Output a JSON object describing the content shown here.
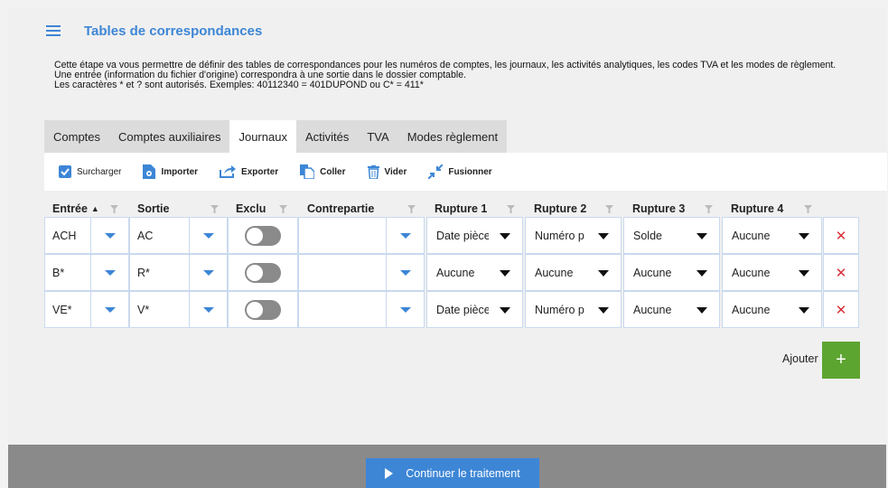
{
  "header": {
    "title": "Tables de correspondances"
  },
  "description": {
    "line1": "Cette étape va vous permettre de définir des tables de correspondances pour les numéros de comptes, les journaux, les activités analytiques, les codes TVA et les modes de règlement.",
    "line2": "Une entrée (information du fichier d'origine) correspondra à une sortie dans le dossier comptable.",
    "line3": "Les caractères * et ? sont autorisés. Exemples: 40112340 = 401DUPOND ou C* = 411*"
  },
  "tabs": [
    {
      "label": "Comptes",
      "active": false
    },
    {
      "label": "Comptes auxiliaires",
      "active": false
    },
    {
      "label": "Journaux",
      "active": true
    },
    {
      "label": "Activités",
      "active": false
    },
    {
      "label": "TVA",
      "active": false
    },
    {
      "label": "Modes règlement",
      "active": false
    }
  ],
  "toolbar": {
    "surcharger": "Surcharger",
    "importer": "Importer",
    "exporter": "Exporter",
    "coller": "Coller",
    "vider": "Vider",
    "fusionner": "Fusionner"
  },
  "columns": {
    "entree": "Entrée",
    "sortie": "Sortie",
    "exclu": "Exclu",
    "contrepartie": "Contrepartie",
    "rupture1": "Rupture 1",
    "rupture2": "Rupture 2",
    "rupture3": "Rupture 3",
    "rupture4": "Rupture 4"
  },
  "rows": [
    {
      "entree": "ACH",
      "sortie": "AC",
      "exclu": false,
      "contrepartie": "",
      "r1": "Date pièce",
      "r2": "Numéro p",
      "r3": "Solde",
      "r4": "Aucune"
    },
    {
      "entree": "B*",
      "sortie": "R*",
      "exclu": false,
      "contrepartie": "",
      "r1": "Aucune",
      "r2": "Aucune",
      "r3": "Aucune",
      "r4": "Aucune"
    },
    {
      "entree": "VE*",
      "sortie": "V*",
      "exclu": false,
      "contrepartie": "",
      "r1": "Date pièce",
      "r2": "Numéro p",
      "r3": "Aucune",
      "r4": "Aucune"
    }
  ],
  "actions": {
    "add_label": "Ajouter",
    "continue_label": "Continuer le traitement"
  },
  "colors": {
    "accent": "#3d86d6",
    "add": "#5da531",
    "delete": "#d9303a"
  }
}
